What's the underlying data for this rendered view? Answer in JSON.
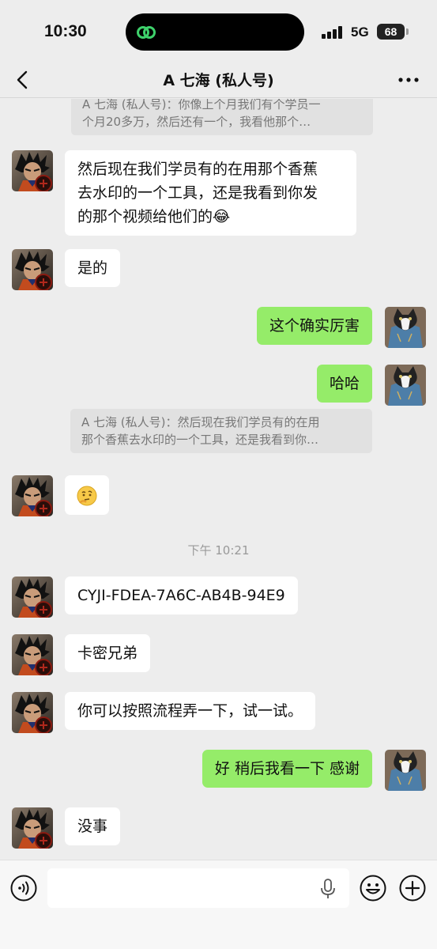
{
  "status": {
    "time": "10:30",
    "network": "5G",
    "battery": "68"
  },
  "nav": {
    "title": "A 七海 (私人号)"
  },
  "messages": {
    "quote1": {
      "line1": "A 七海 (私人号)：你像上个月我们有个学员一",
      "line2": "个月20多万，然后还有一个，我看他那个…"
    },
    "m1": {
      "line1": "然后现在我们学员有的在用那个香蕉",
      "line2": "去水印的一个工具，还是我看到你发",
      "line3": "的那个视频给他们的😂"
    },
    "m2": "是的",
    "m3": "这个确实厉害",
    "m4": "哈哈",
    "quote2": {
      "line1": "A 七海 (私人号)：然后现在我们学员有的在用",
      "line2": "那个香蕉去水印的一个工具，还是我看到你…"
    },
    "m5": "🤔",
    "timestamp": "下午 10:21",
    "m6": "CYJI-FDEA-7A6C-AB4B-94E9",
    "m7": "卡密兄弟",
    "m8": "你可以按照流程弄一下，试一试。",
    "m9": "好 稍后我看一下 感谢",
    "m10": "没事"
  },
  "input": {
    "value": "",
    "placeholder": ""
  },
  "icons": {
    "voice": "voice-icon",
    "emoji": "emoji-icon",
    "plus": "plus-icon",
    "mic": "mic-icon",
    "back": "back-chevron-icon",
    "more": "more-icon"
  },
  "colors": {
    "outgoing_bubble": "#95ec69",
    "incoming_bubble": "#ffffff",
    "background": "#ededed"
  }
}
